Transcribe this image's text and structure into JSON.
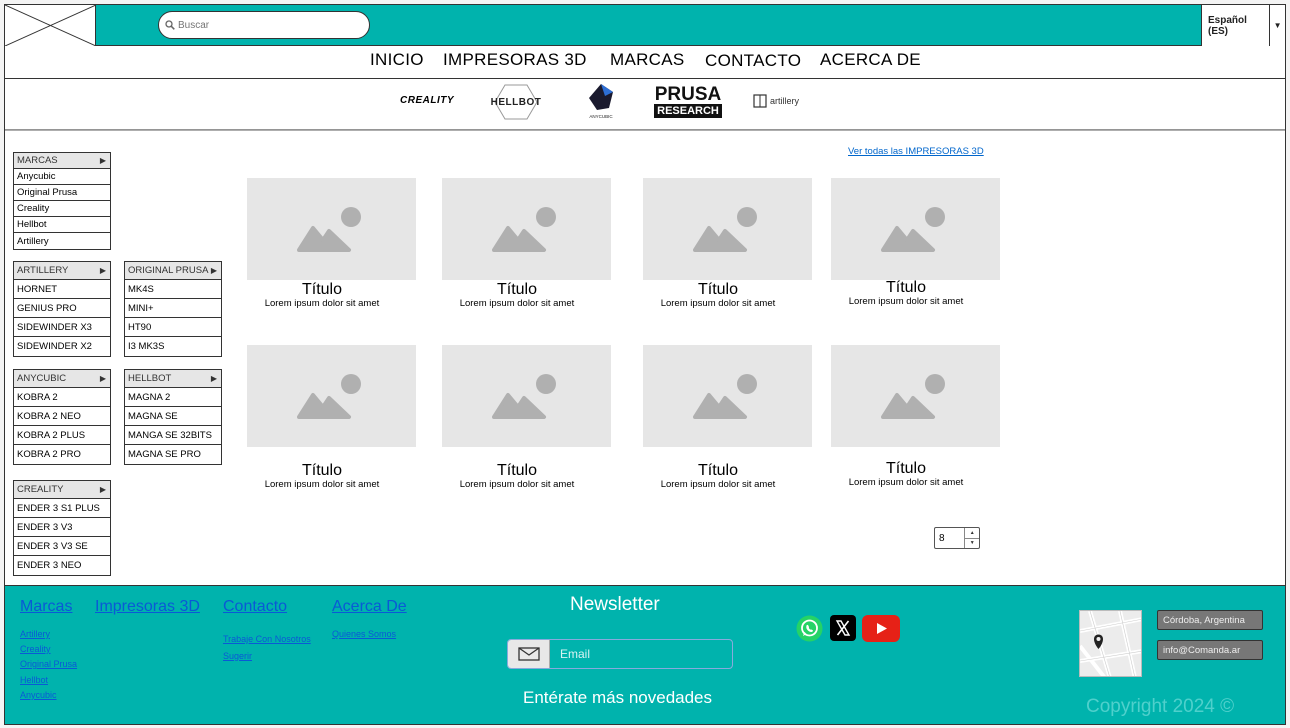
{
  "header": {
    "search_placeholder": "Buscar",
    "language": "Español (ES)"
  },
  "nav": {
    "items": [
      "INICIO",
      "IMPRESORAS 3D",
      "MARCAS",
      "CONTACTO",
      "ACERCA DE"
    ]
  },
  "brand_logos": {
    "creality": "CREALITY",
    "hellbot": "HELLBOT",
    "anycubic": "ANYCUBIC",
    "prusa_top": "PRUSA",
    "prusa_bottom": "RESEARCH",
    "artillery": "artillery"
  },
  "menus": {
    "marcas": {
      "title": "MARCAS",
      "items": [
        "Anycubic",
        "Original Prusa",
        "Creality",
        "Hellbot",
        "Artillery"
      ]
    },
    "artillery": {
      "title": "ARTILLERY",
      "items": [
        "HORNET",
        "GENIUS PRO",
        "SIDEWINDER X3",
        "SIDEWINDER X2"
      ]
    },
    "prusa": {
      "title": "ORIGINAL PRUSA",
      "items": [
        "MK4S",
        "MINI+",
        "HT90",
        "I3 MK3S"
      ]
    },
    "anycubic": {
      "title": "ANYCUBIC",
      "items": [
        "KOBRA 2",
        "KOBRA 2 NEO",
        "KOBRA 2 PLUS",
        "KOBRA 2 PRO"
      ]
    },
    "hellbot": {
      "title": "HELLBOT",
      "items": [
        "MAGNA 2",
        "MAGNA SE",
        "MANGA SE 32BITS",
        "MAGNA SE PRO"
      ]
    },
    "creality": {
      "title": "CREALITY",
      "items": [
        "ENDER 3 S1 PLUS",
        "ENDER 3 V3",
        "ENDER 3 V3 SE",
        "ENDER 3 NEO"
      ]
    }
  },
  "products": {
    "see_all": "Ver todas las IMPRESORAS 3D",
    "cards": [
      {
        "title": "Título",
        "desc": "Lorem ipsum dolor sit amet"
      },
      {
        "title": "Título",
        "desc": "Lorem ipsum dolor sit amet"
      },
      {
        "title": "Título",
        "desc": "Lorem ipsum dolor sit amet"
      },
      {
        "title": "Título",
        "desc": "Lorem ipsum dolor sit amet"
      },
      {
        "title": "Título",
        "desc": "Lorem ipsum dolor sit amet"
      },
      {
        "title": "Título",
        "desc": "Lorem ipsum dolor sit amet"
      },
      {
        "title": "Título",
        "desc": "Lorem ipsum dolor sit amet"
      },
      {
        "title": "Título",
        "desc": "Lorem ipsum dolor sit amet"
      }
    ],
    "per_page": "8"
  },
  "footer": {
    "marcas": {
      "title": "Marcas",
      "links": [
        "Artillery",
        "Creality",
        "Original Prusa",
        "Hellbot",
        "Anycubic"
      ]
    },
    "impresoras": {
      "title": "Impresoras 3D"
    },
    "contacto": {
      "title": "Contacto",
      "links": [
        "Trabaje Con Nosotros",
        "Sugerir"
      ]
    },
    "acerca": {
      "title": "Acerca De",
      "links": [
        "Quienes Somos"
      ]
    },
    "newsletter_title": "Newsletter",
    "email_placeholder": "Email",
    "newsletter_sub": "Entérate más novedades",
    "location": "Córdoba, Argentina",
    "email": "info@Comanda.ar",
    "copyright": "Copyright 2024 ©"
  },
  "colors": {
    "primary": "#00b3ad",
    "whatsapp": "#25d366",
    "youtube": "#e62117",
    "x": "#000000"
  }
}
